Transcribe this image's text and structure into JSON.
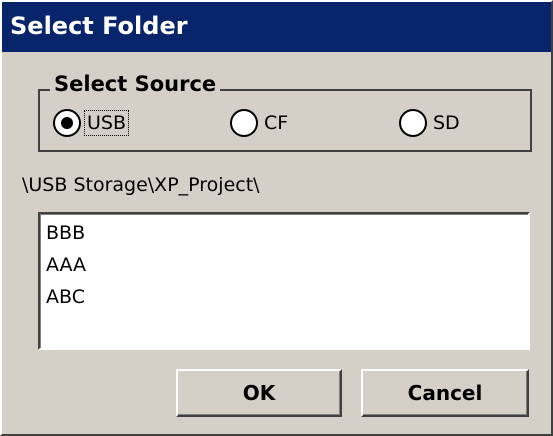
{
  "dialog": {
    "title": "Select Folder"
  },
  "source_group": {
    "label": "Select Source",
    "options": [
      {
        "label": "USB",
        "selected": true
      },
      {
        "label": "CF",
        "selected": false
      },
      {
        "label": "SD",
        "selected": false
      }
    ]
  },
  "current_path": "\\USB Storage\\XP_Project\\",
  "folders": [
    {
      "name": "BBB"
    },
    {
      "name": "AAA"
    },
    {
      "name": "ABC"
    }
  ],
  "buttons": {
    "ok_label": "OK",
    "cancel_label": "Cancel"
  },
  "colors": {
    "titlebar": "#08246b",
    "face": "#d4d0c8"
  }
}
